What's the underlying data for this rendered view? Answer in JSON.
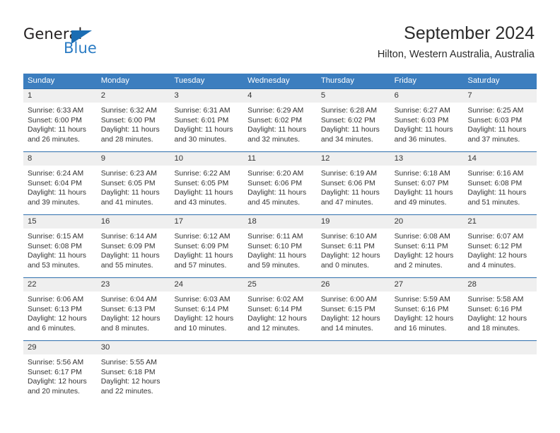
{
  "logo": {
    "word_dark": "General",
    "word_blue": "Blue",
    "triangle_color": "#1b6db3",
    "blue_color": "#2b7cc4"
  },
  "header": {
    "title": "September 2024",
    "subtitle": "Hilton, Western Australia, Australia"
  },
  "theme": {
    "header_blue": "#3c7ebf",
    "grid_line": "#2f6fad",
    "day_band": "#efefef",
    "text": "#333333"
  },
  "weekdays": [
    "Sunday",
    "Monday",
    "Tuesday",
    "Wednesday",
    "Thursday",
    "Friday",
    "Saturday"
  ],
  "weeks": [
    [
      {
        "day": "1",
        "sunrise": "Sunrise: 6:33 AM",
        "sunset": "Sunset: 6:00 PM",
        "daylight1": "Daylight: 11 hours",
        "daylight2": "and 26 minutes."
      },
      {
        "day": "2",
        "sunrise": "Sunrise: 6:32 AM",
        "sunset": "Sunset: 6:00 PM",
        "daylight1": "Daylight: 11 hours",
        "daylight2": "and 28 minutes."
      },
      {
        "day": "3",
        "sunrise": "Sunrise: 6:31 AM",
        "sunset": "Sunset: 6:01 PM",
        "daylight1": "Daylight: 11 hours",
        "daylight2": "and 30 minutes."
      },
      {
        "day": "4",
        "sunrise": "Sunrise: 6:29 AM",
        "sunset": "Sunset: 6:02 PM",
        "daylight1": "Daylight: 11 hours",
        "daylight2": "and 32 minutes."
      },
      {
        "day": "5",
        "sunrise": "Sunrise: 6:28 AM",
        "sunset": "Sunset: 6:02 PM",
        "daylight1": "Daylight: 11 hours",
        "daylight2": "and 34 minutes."
      },
      {
        "day": "6",
        "sunrise": "Sunrise: 6:27 AM",
        "sunset": "Sunset: 6:03 PM",
        "daylight1": "Daylight: 11 hours",
        "daylight2": "and 36 minutes."
      },
      {
        "day": "7",
        "sunrise": "Sunrise: 6:25 AM",
        "sunset": "Sunset: 6:03 PM",
        "daylight1": "Daylight: 11 hours",
        "daylight2": "and 37 minutes."
      }
    ],
    [
      {
        "day": "8",
        "sunrise": "Sunrise: 6:24 AM",
        "sunset": "Sunset: 6:04 PM",
        "daylight1": "Daylight: 11 hours",
        "daylight2": "and 39 minutes."
      },
      {
        "day": "9",
        "sunrise": "Sunrise: 6:23 AM",
        "sunset": "Sunset: 6:05 PM",
        "daylight1": "Daylight: 11 hours",
        "daylight2": "and 41 minutes."
      },
      {
        "day": "10",
        "sunrise": "Sunrise: 6:22 AM",
        "sunset": "Sunset: 6:05 PM",
        "daylight1": "Daylight: 11 hours",
        "daylight2": "and 43 minutes."
      },
      {
        "day": "11",
        "sunrise": "Sunrise: 6:20 AM",
        "sunset": "Sunset: 6:06 PM",
        "daylight1": "Daylight: 11 hours",
        "daylight2": "and 45 minutes."
      },
      {
        "day": "12",
        "sunrise": "Sunrise: 6:19 AM",
        "sunset": "Sunset: 6:06 PM",
        "daylight1": "Daylight: 11 hours",
        "daylight2": "and 47 minutes."
      },
      {
        "day": "13",
        "sunrise": "Sunrise: 6:18 AM",
        "sunset": "Sunset: 6:07 PM",
        "daylight1": "Daylight: 11 hours",
        "daylight2": "and 49 minutes."
      },
      {
        "day": "14",
        "sunrise": "Sunrise: 6:16 AM",
        "sunset": "Sunset: 6:08 PM",
        "daylight1": "Daylight: 11 hours",
        "daylight2": "and 51 minutes."
      }
    ],
    [
      {
        "day": "15",
        "sunrise": "Sunrise: 6:15 AM",
        "sunset": "Sunset: 6:08 PM",
        "daylight1": "Daylight: 11 hours",
        "daylight2": "and 53 minutes."
      },
      {
        "day": "16",
        "sunrise": "Sunrise: 6:14 AM",
        "sunset": "Sunset: 6:09 PM",
        "daylight1": "Daylight: 11 hours",
        "daylight2": "and 55 minutes."
      },
      {
        "day": "17",
        "sunrise": "Sunrise: 6:12 AM",
        "sunset": "Sunset: 6:09 PM",
        "daylight1": "Daylight: 11 hours",
        "daylight2": "and 57 minutes."
      },
      {
        "day": "18",
        "sunrise": "Sunrise: 6:11 AM",
        "sunset": "Sunset: 6:10 PM",
        "daylight1": "Daylight: 11 hours",
        "daylight2": "and 59 minutes."
      },
      {
        "day": "19",
        "sunrise": "Sunrise: 6:10 AM",
        "sunset": "Sunset: 6:11 PM",
        "daylight1": "Daylight: 12 hours",
        "daylight2": "and 0 minutes."
      },
      {
        "day": "20",
        "sunrise": "Sunrise: 6:08 AM",
        "sunset": "Sunset: 6:11 PM",
        "daylight1": "Daylight: 12 hours",
        "daylight2": "and 2 minutes."
      },
      {
        "day": "21",
        "sunrise": "Sunrise: 6:07 AM",
        "sunset": "Sunset: 6:12 PM",
        "daylight1": "Daylight: 12 hours",
        "daylight2": "and 4 minutes."
      }
    ],
    [
      {
        "day": "22",
        "sunrise": "Sunrise: 6:06 AM",
        "sunset": "Sunset: 6:13 PM",
        "daylight1": "Daylight: 12 hours",
        "daylight2": "and 6 minutes."
      },
      {
        "day": "23",
        "sunrise": "Sunrise: 6:04 AM",
        "sunset": "Sunset: 6:13 PM",
        "daylight1": "Daylight: 12 hours",
        "daylight2": "and 8 minutes."
      },
      {
        "day": "24",
        "sunrise": "Sunrise: 6:03 AM",
        "sunset": "Sunset: 6:14 PM",
        "daylight1": "Daylight: 12 hours",
        "daylight2": "and 10 minutes."
      },
      {
        "day": "25",
        "sunrise": "Sunrise: 6:02 AM",
        "sunset": "Sunset: 6:14 PM",
        "daylight1": "Daylight: 12 hours",
        "daylight2": "and 12 minutes."
      },
      {
        "day": "26",
        "sunrise": "Sunrise: 6:00 AM",
        "sunset": "Sunset: 6:15 PM",
        "daylight1": "Daylight: 12 hours",
        "daylight2": "and 14 minutes."
      },
      {
        "day": "27",
        "sunrise": "Sunrise: 5:59 AM",
        "sunset": "Sunset: 6:16 PM",
        "daylight1": "Daylight: 12 hours",
        "daylight2": "and 16 minutes."
      },
      {
        "day": "28",
        "sunrise": "Sunrise: 5:58 AM",
        "sunset": "Sunset: 6:16 PM",
        "daylight1": "Daylight: 12 hours",
        "daylight2": "and 18 minutes."
      }
    ],
    [
      {
        "day": "29",
        "sunrise": "Sunrise: 5:56 AM",
        "sunset": "Sunset: 6:17 PM",
        "daylight1": "Daylight: 12 hours",
        "daylight2": "and 20 minutes."
      },
      {
        "day": "30",
        "sunrise": "Sunrise: 5:55 AM",
        "sunset": "Sunset: 6:18 PM",
        "daylight1": "Daylight: 12 hours",
        "daylight2": "and 22 minutes."
      },
      {
        "day": "",
        "sunrise": "",
        "sunset": "",
        "daylight1": "",
        "daylight2": ""
      },
      {
        "day": "",
        "sunrise": "",
        "sunset": "",
        "daylight1": "",
        "daylight2": ""
      },
      {
        "day": "",
        "sunrise": "",
        "sunset": "",
        "daylight1": "",
        "daylight2": ""
      },
      {
        "day": "",
        "sunrise": "",
        "sunset": "",
        "daylight1": "",
        "daylight2": ""
      },
      {
        "day": "",
        "sunrise": "",
        "sunset": "",
        "daylight1": "",
        "daylight2": ""
      }
    ]
  ]
}
